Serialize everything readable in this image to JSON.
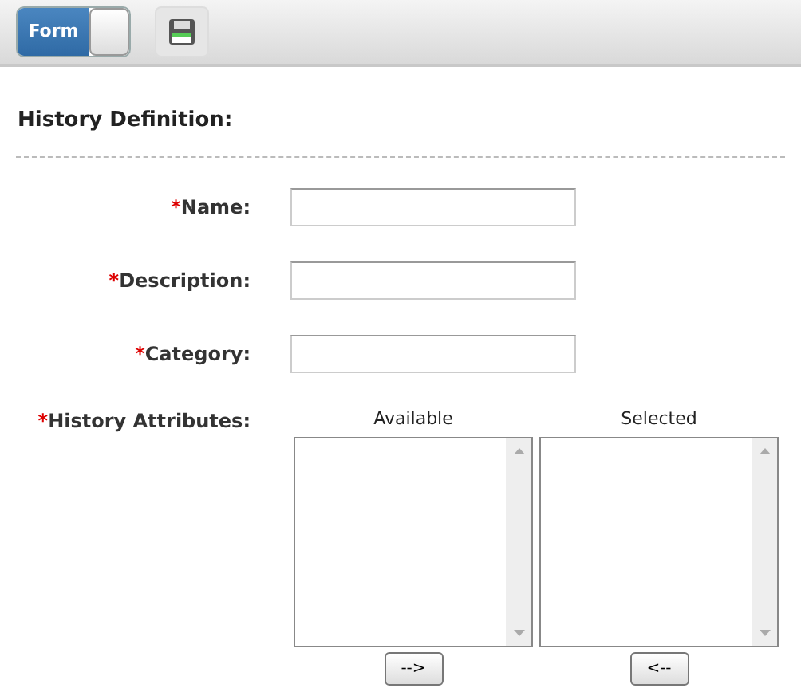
{
  "toolbar": {
    "toggle": {
      "label": "Form",
      "on": true
    }
  },
  "heading": "History Definition:",
  "fields": [
    {
      "required_mark": "*",
      "label": "Name:"
    },
    {
      "required_mark": "*",
      "label": "Description:"
    },
    {
      "required_mark": "*",
      "label": "Category:"
    }
  ],
  "attributes": {
    "required_mark": "*",
    "label": "History Attributes:",
    "lists": [
      {
        "heading": "Available",
        "button": "-->"
      },
      {
        "heading": "Selected",
        "button": "<--"
      }
    ]
  }
}
